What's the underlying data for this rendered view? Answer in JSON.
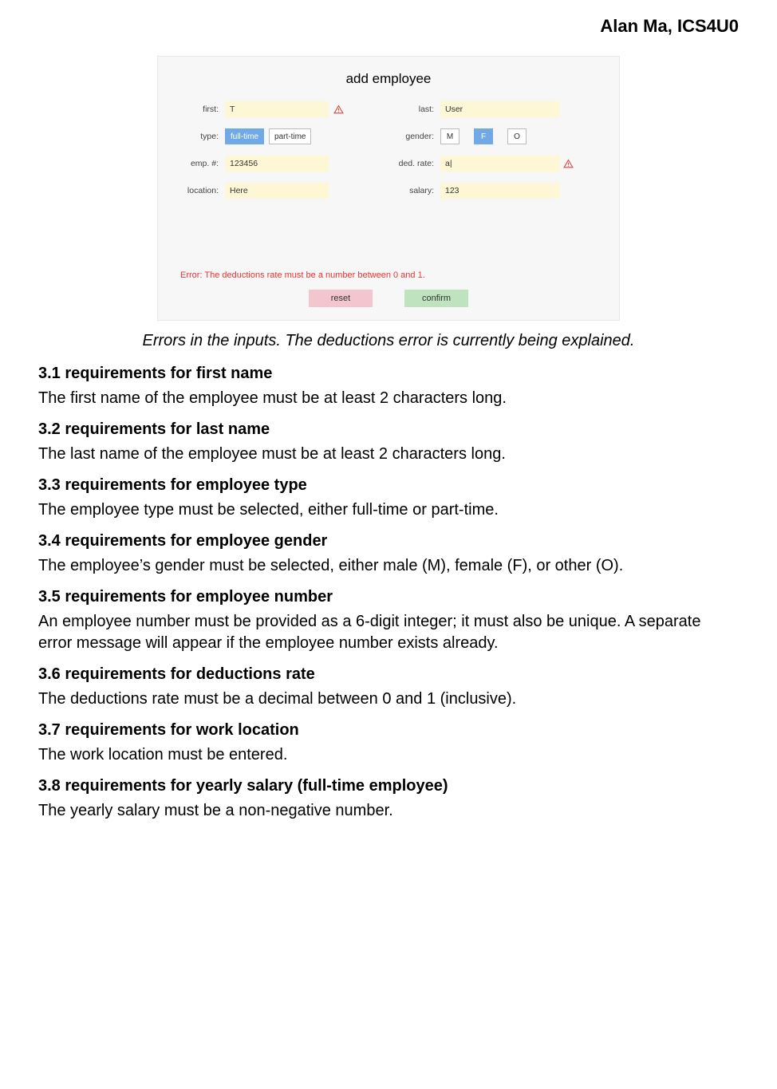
{
  "header": {
    "text": "Alan Ma, ICS4U0"
  },
  "app": {
    "title": "add employee",
    "labels": {
      "first": "first:",
      "last": "last:",
      "type": "type:",
      "gender": "gender:",
      "empnum": "emp. #:",
      "dedrate": "ded. rate:",
      "location": "location:",
      "salary": "salary:"
    },
    "values": {
      "first": "T",
      "last": "User",
      "empnum": "123456",
      "dedrate": "a|",
      "location": "Here",
      "salary": "123"
    },
    "type_options": {
      "full": "full-time",
      "part": "part-time"
    },
    "gender_options": {
      "m": "M",
      "f": "F",
      "o": "O"
    },
    "error": "Error: The deductions rate must be a number between 0 and 1.",
    "buttons": {
      "reset": "reset",
      "confirm": "confirm"
    }
  },
  "caption": "Errors in the inputs. The deductions error is currently being explained.",
  "sections": [
    {
      "h": "3.1 requirements for first name",
      "p": "The first name of the employee must be at least 2 characters long."
    },
    {
      "h": "3.2 requirements for last name",
      "p": "The last name of the employee must be at least 2 characters long."
    },
    {
      "h": "3.3 requirements for employee type",
      "p": "The employee type must be selected, either full-time or part-time."
    },
    {
      "h": "3.4 requirements for employee gender",
      "p": "The employee’s gender must be selected, either male (M), female (F), or other (O)."
    },
    {
      "h": "3.5 requirements for employee number",
      "p": "An employee number must be provided as a 6-digit integer; it must also be unique. A separate error message will appear if the employee number exists already."
    },
    {
      "h": "3.6 requirements for deductions rate",
      "p": "The deductions rate must be a decimal between 0 and 1 (inclusive)."
    },
    {
      "h": "3.7 requirements for work location",
      "p": "The work location must be entered."
    },
    {
      "h": "3.8 requirements for yearly salary (full-time employee)",
      "p": "The yearly salary must be a non-negative number."
    }
  ]
}
